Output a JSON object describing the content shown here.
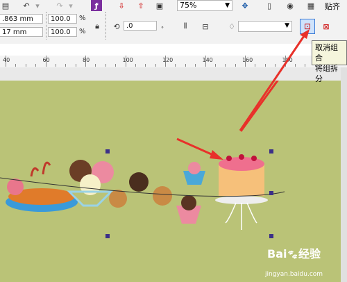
{
  "toolbar_top": {
    "zoom_value": "75%",
    "paste_label": "贴齐"
  },
  "toolbar_props": {
    "x_value": ".863 mm",
    "y_value": "17 mm",
    "scale_w": "100.0",
    "scale_h": "100.0",
    "percent": "%",
    "rotation": ".0",
    "outline_width": ""
  },
  "tooltip": {
    "title": "取消组合",
    "desc": "将组拆分"
  },
  "ruler": {
    "labels": [
      "40",
      "60",
      "80",
      "100",
      "120",
      "140",
      "160",
      "180"
    ]
  },
  "watermark": {
    "brand": "Bai",
    "brand2": "经验",
    "url": "jingyan.baidu.com"
  }
}
